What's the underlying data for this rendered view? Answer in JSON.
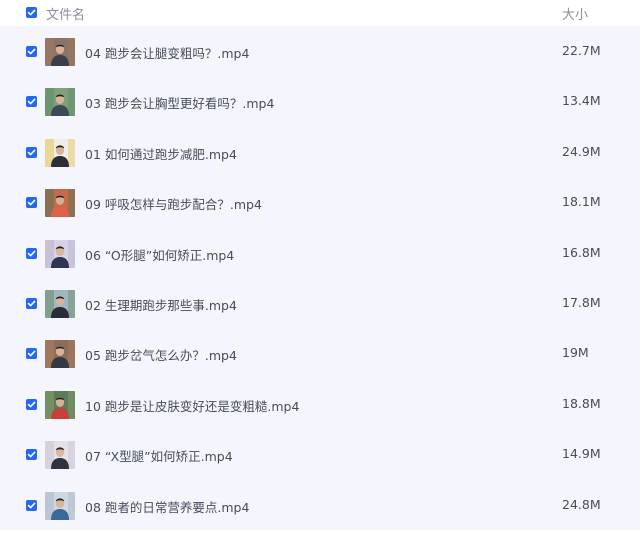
{
  "header": {
    "name_label": "文件名",
    "size_label": "大小"
  },
  "colors": {
    "accent": "#2468f2",
    "row_bg": "#f5f6fd",
    "text": "#454d5a",
    "header_text": "#8c8f9a"
  },
  "files": [
    {
      "name": "04 跑步会让腿变粗吗？.mp4",
      "size": "22.7M",
      "selected": true,
      "thumb": {
        "bg": "#8a7466",
        "shirt": "#3b3f4c",
        "skin": "#d9b49a",
        "accent": "#a07a60"
      }
    },
    {
      "name": "03 跑步会让胸型更好看吗？.mp4",
      "size": "13.4M",
      "selected": true,
      "thumb": {
        "bg": "#7fa07a",
        "shirt": "#3a4a5a",
        "skin": "#d8b59c",
        "accent": "#5f8a6a"
      }
    },
    {
      "name": "01 如何通过跑步减肥.mp4",
      "size": "24.9M",
      "selected": true,
      "thumb": {
        "bg": "#f0eee8",
        "shirt": "#2c2f38",
        "skin": "#d8b39a",
        "accent": "#e6c350"
      }
    },
    {
      "name": "09 呼吸怎样与跑步配合？.mp4",
      "size": "18.1M",
      "selected": true,
      "thumb": {
        "bg": "#c9694a",
        "shirt": "#e0604a",
        "skin": "#d6ae92",
        "accent": "#4a7a5a"
      }
    },
    {
      "name": "06 “O形腿”如何矫正.mp4",
      "size": "16.8M",
      "selected": true,
      "thumb": {
        "bg": "#d8d2e4",
        "shirt": "#2d3550",
        "skin": "#dab69d",
        "accent": "#b9b2cc"
      }
    },
    {
      "name": "02 生理期跑步那些事.mp4",
      "size": "17.8M",
      "selected": true,
      "thumb": {
        "bg": "#9cb8c6",
        "shirt": "#2a2e36",
        "skin": "#d8b49b",
        "accent": "#6c8a5c"
      }
    },
    {
      "name": "05 跑步岔气怎么办？.mp4",
      "size": "19M",
      "selected": true,
      "thumb": {
        "bg": "#8a6e5a",
        "shirt": "#34383f",
        "skin": "#d7b298",
        "accent": "#b08060"
      }
    },
    {
      "name": "10 跑步是让皮肤变好还是变粗糙.mp4",
      "size": "18.8M",
      "selected": true,
      "thumb": {
        "bg": "#5a7a5a",
        "shirt": "#c8403a",
        "skin": "#d7b09a",
        "accent": "#8aa070"
      }
    },
    {
      "name": "07 “X型腿”如何矫正.mp4",
      "size": "14.9M",
      "selected": true,
      "thumb": {
        "bg": "#e4e2e6",
        "shirt": "#2e3242",
        "skin": "#dab79e",
        "accent": "#c8c4cc"
      }
    },
    {
      "name": "08 跑者的日常营养要点.mp4",
      "size": "24.8M",
      "selected": true,
      "thumb": {
        "bg": "#cfd8e2",
        "shirt": "#3a6a9a",
        "skin": "#d8b49c",
        "accent": "#aab8c6"
      }
    }
  ]
}
